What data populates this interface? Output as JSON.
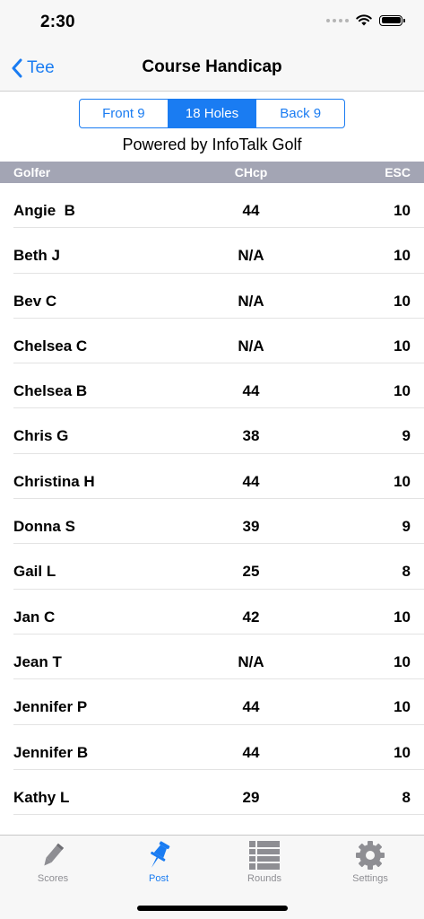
{
  "status_bar": {
    "time": "2:30"
  },
  "nav": {
    "back_label": "Tee",
    "title": "Course Handicap"
  },
  "segments": [
    {
      "label": "Front 9",
      "selected": false
    },
    {
      "label": "18 Holes",
      "selected": true
    },
    {
      "label": "Back 9",
      "selected": false
    }
  ],
  "powered_by": "Powered by InfoTalk Golf",
  "table": {
    "headers": {
      "golfer": "Golfer",
      "chcp": "CHcp",
      "esc": "ESC"
    },
    "rows": [
      {
        "golfer": "Angie  B",
        "chcp": "44",
        "esc": "10"
      },
      {
        "golfer": "Beth J",
        "chcp": "N/A",
        "esc": "10"
      },
      {
        "golfer": "Bev C",
        "chcp": "N/A",
        "esc": "10"
      },
      {
        "golfer": "Chelsea C",
        "chcp": "N/A",
        "esc": "10"
      },
      {
        "golfer": "Chelsea B",
        "chcp": "44",
        "esc": "10"
      },
      {
        "golfer": "Chris G",
        "chcp": "38",
        "esc": "9"
      },
      {
        "golfer": "Christina H",
        "chcp": "44",
        "esc": "10"
      },
      {
        "golfer": "Donna S",
        "chcp": "39",
        "esc": "9"
      },
      {
        "golfer": "Gail L",
        "chcp": "25",
        "esc": "8"
      },
      {
        "golfer": "Jan C",
        "chcp": "42",
        "esc": "10"
      },
      {
        "golfer": "Jean T",
        "chcp": "N/A",
        "esc": "10"
      },
      {
        "golfer": "Jennifer P",
        "chcp": "44",
        "esc": "10"
      },
      {
        "golfer": "Jennifer B",
        "chcp": "44",
        "esc": "10"
      },
      {
        "golfer": "Kathy L",
        "chcp": "29",
        "esc": "8"
      }
    ]
  },
  "tabs": [
    {
      "label": "Scores",
      "icon": "pencil-icon",
      "active": false
    },
    {
      "label": "Post",
      "icon": "pushpin-icon",
      "active": true
    },
    {
      "label": "Rounds",
      "icon": "list-icon",
      "active": false
    },
    {
      "label": "Settings",
      "icon": "gear-icon",
      "active": false
    }
  ],
  "colors": {
    "accent": "#1a7cf2",
    "header_bg": "#a3a5b4",
    "inactive_tab": "#8e8e93",
    "bar_bg": "#f7f7f7"
  }
}
